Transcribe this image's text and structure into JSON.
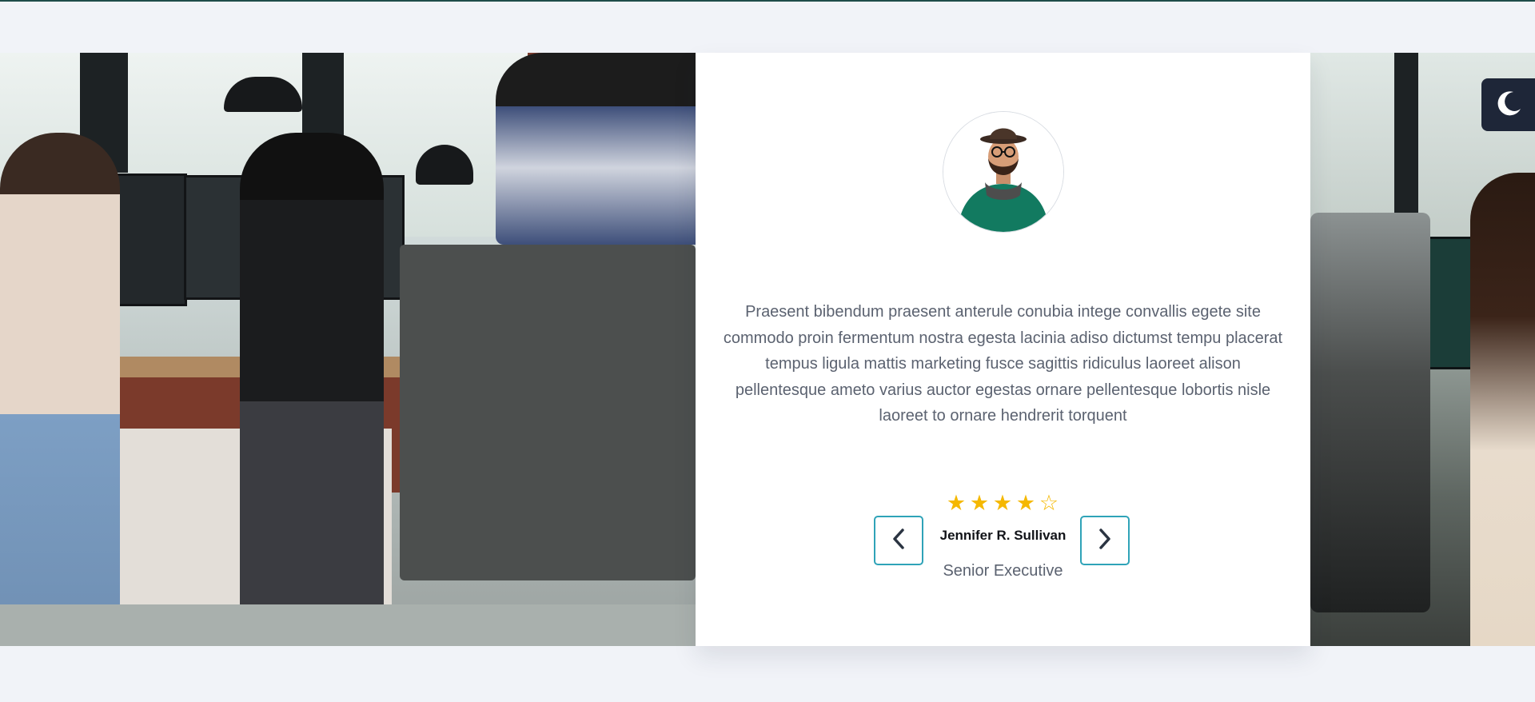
{
  "testimonial": {
    "quote": "Praesent bibendum praesent anterule conubia intege convallis egete site commodo proin fermentum nostra egesta lacinia adiso dictumst tempu placerat tempus ligula mattis marketing fusce sagittis ridiculus laoreet alison pellentesque ameto varius auctor egestas ornare pellentesque lobortis nisle laoreet to ornare hendrerit torquent",
    "rating": 4,
    "rating_max": 5,
    "author_name": "Jennifer R. Sullivan",
    "author_role": "Senior Executive",
    "prev_icon": "chevron-left-icon",
    "next_icon": "chevron-right-icon"
  },
  "theme_toggle": {
    "icon": "moon-icon"
  },
  "colors": {
    "page_background": "#f1f3f8",
    "card_background": "#ffffff",
    "accent_border": "#2fa3b8",
    "star": "#f5b800",
    "toggle_background": "#1e2638",
    "text_muted": "#5b6270",
    "text_dark": "#111318"
  }
}
